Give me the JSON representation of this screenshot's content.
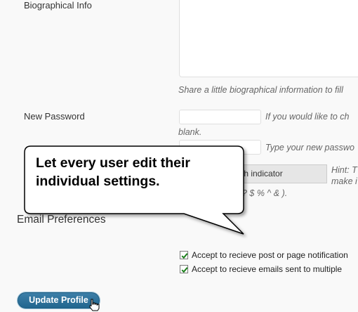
{
  "fields": {
    "bio_label": "Biographical Info",
    "bio_hint": "Share a little biographical information to fill",
    "password_label": "New Password",
    "password_hint_1": "If you would like to ch",
    "password_hint_2": "blank.",
    "password_confirm_hint": "Type your new passwo",
    "strength_indicator": "th indicator",
    "strength_hint_1": "Hint: T",
    "strength_hint_2": "make i",
    "strength_hint_3": "? $ % ^ & )."
  },
  "email_prefs": {
    "heading": "Email Preferences",
    "options": [
      {
        "label": "Accept to recieve post or page notification",
        "checked": true
      },
      {
        "label": "Accept to recieve emails sent to multiple",
        "checked": true
      }
    ]
  },
  "actions": {
    "update_label": "Update Profile"
  },
  "callout": {
    "text": "Let every user edit their individual settings."
  }
}
